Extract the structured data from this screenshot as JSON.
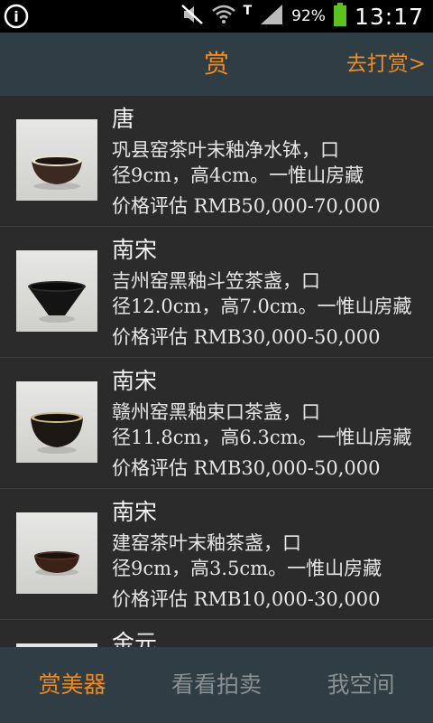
{
  "status_bar": {
    "battery": "92%",
    "time": "13:17"
  },
  "header": {
    "title": "赏",
    "action": "去打赏>"
  },
  "items": [
    {
      "dynasty": "唐",
      "desc_line1": "巩县窑茶叶末釉净水钵，口",
      "desc_line2": "径9cm，高4cm。一惟山房藏",
      "price": "价格评估 RMB50,000-70,000"
    },
    {
      "dynasty": "南宋",
      "desc_line1": "吉州窑黑釉斗笠茶盏，口",
      "desc_line2": "径12.0cm，高7.0cm。一惟山房藏",
      "price": "价格评估 RMB30,000-50,000"
    },
    {
      "dynasty": "南宋",
      "desc_line1": "赣州窑黑釉束口茶盏，口",
      "desc_line2": "径11.8cm，高6.3cm。一惟山房藏",
      "price": "价格评估 RMB30,000-50,000"
    },
    {
      "dynasty": "南宋",
      "desc_line1": "建窑茶叶末釉茶盏，口",
      "desc_line2": "径9cm，高3.5cm。一惟山房藏",
      "price": "价格评估 RMB10,000-30,000"
    },
    {
      "dynasty": "金元"
    }
  ],
  "bottom_tabs": [
    {
      "label": "赏美器",
      "active": true
    },
    {
      "label": "看看拍卖",
      "active": false
    },
    {
      "label": "我空间",
      "active": false
    }
  ],
  "colors": {
    "accent": "#f08a1c",
    "bar": "#2f3d45",
    "inactive_tab": "#8a8f92"
  }
}
